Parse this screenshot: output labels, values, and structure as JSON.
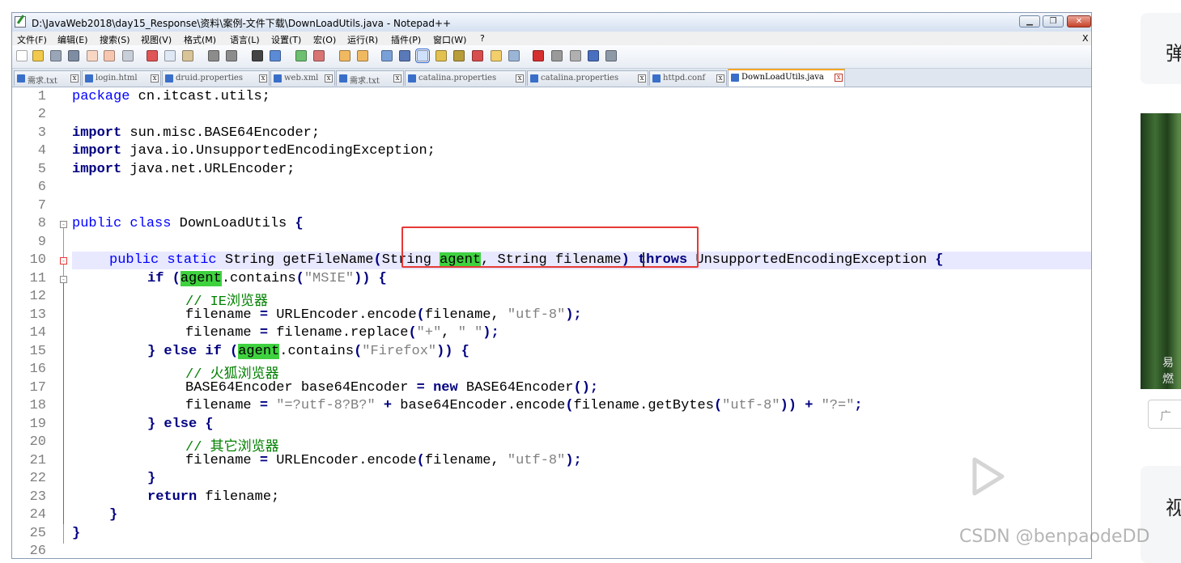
{
  "window": {
    "title": "D:\\JavaWeb2018\\day15_Response\\资料\\案例-文件下载\\DownLoadUtils.java - Notepad++",
    "minimize_glyph": "▁",
    "maximize_glyph": "❐",
    "close_glyph": "✕"
  },
  "menubar": {
    "items": [
      "文件(F)",
      "编辑(E)",
      "搜索(S)",
      "视图(V)",
      "格式(M)",
      "语言(L)",
      "设置(T)",
      "宏(O)",
      "运行(R)",
      "插件(P)",
      "窗口(W)",
      "?"
    ],
    "close_label": "X"
  },
  "tabs": [
    {
      "label": "需求.txt",
      "active": false
    },
    {
      "label": "login.html",
      "active": false
    },
    {
      "label": "druid.properties",
      "active": false
    },
    {
      "label": "web.xml",
      "active": false
    },
    {
      "label": "需求.txt",
      "active": false
    },
    {
      "label": "catalina.properties",
      "active": false
    },
    {
      "label": "catalina.properties",
      "active": false
    },
    {
      "label": "httpd.conf",
      "active": false
    },
    {
      "label": "DownLoadUtils.java",
      "active": true
    }
  ],
  "tab_close_glyph": "x",
  "editor": {
    "line_numbers": [
      "1",
      "2",
      "3",
      "4",
      "5",
      "6",
      "7",
      "8",
      "9",
      "10",
      "11",
      "12",
      "13",
      "14",
      "15",
      "16",
      "17",
      "18",
      "19",
      "20",
      "21",
      "22",
      "23",
      "24",
      "25",
      "26"
    ],
    "code": {
      "l1_kw": "package",
      "l1_rest": " cn.itcast.utils;",
      "l3_kw": "import",
      "l3_rest": " sun.misc.BASE64Encoder;",
      "l4_kw": "import",
      "l4_rest": " java.io.UnsupportedEncodingException;",
      "l5_kw": "import",
      "l5_rest": " java.net.URLEncoder;",
      "l8_kw1": "public",
      "l8_kw2": "class",
      "l8_rest": " DownLoadUtils ",
      "l8_brace": "{",
      "l10_kw1": "public",
      "l10_kw2": "static",
      "l10_a": " String getFileName",
      "l10_p1": "(",
      "l10_b": "String ",
      "l10_agent": "agent",
      "l10_c": ", String filename",
      "l10_p2": ")",
      "l10_throws": "throws",
      "l10_d": " UnsupportedEncodingException ",
      "l10_brace": "{",
      "l11_kw": "if",
      "l11_p1": " (",
      "l11_agent": "agent",
      "l11_a": ".contains",
      "l11_p2": "(",
      "l11_str": "\"MSIE\"",
      "l11_p3": ")) {",
      "l12_cm": "// IE浏览器",
      "l13_a": "filename ",
      "l13_op": "=",
      "l13_b": " URLEncoder.encode",
      "l13_p1": "(",
      "l13_c": "filename, ",
      "l13_str": "\"utf-8\"",
      "l13_p2": ");",
      "l14_a": "filename ",
      "l14_op": "=",
      "l14_b": " filename.replace",
      "l14_p1": "(",
      "l14_str1": "\"+\"",
      "l14_c": ", ",
      "l14_str2": "\" \"",
      "l14_p2": ");",
      "l15_p1": "} ",
      "l15_kw1": "else",
      "l15_kw2": "if",
      "l15_p2": " (",
      "l15_agent": "agent",
      "l15_a": ".contains",
      "l15_p3": "(",
      "l15_str": "\"Firefox\"",
      "l15_p4": ")) {",
      "l16_cm": "// 火狐浏览器",
      "l17_a": "BASE64Encoder base64Encoder ",
      "l17_op": "=",
      "l17_kw": "new",
      "l17_b": " BASE64Encoder",
      "l17_p": "();",
      "l18_a": "filename ",
      "l18_op": "=",
      "l18_str1": "\"=?utf-8?B?\"",
      "l18_op2": "+",
      "l18_b": " base64Encoder.encode",
      "l18_p1": "(",
      "l18_c": "filename.getBytes",
      "l18_p2": "(",
      "l18_str2": "\"utf-8\"",
      "l18_p3": "))",
      "l18_op3": "+",
      "l18_str3": "\"?=\"",
      "l18_p4": ";",
      "l19_p1": "} ",
      "l19_kw": "else",
      "l19_p2": " {",
      "l20_cm": "// 其它浏览器",
      "l21_a": "filename ",
      "l21_op": "=",
      "l21_b": " URLEncoder.encode",
      "l21_p1": "(",
      "l21_c": "filename, ",
      "l21_str": "\"utf-8\"",
      "l21_p2": ");",
      "l22_p": "}",
      "l23_kw": "return",
      "l23_rest": " filename;",
      "l24_p": "}",
      "l25_p": "}"
    }
  },
  "page": {
    "sidebar_char_top": "弹",
    "sidebar_image_text": "易燃",
    "sidebar_btn_text": "广",
    "sidebar_char_bottom": "视",
    "watermark": "CSDN @benpaodeDD"
  },
  "colors": {
    "keyword_blue": "#0000ff",
    "keyword_bold": "#000080",
    "string_gray": "#808080",
    "comment_green": "#008000",
    "highlight_green": "#3fd23f",
    "annotation_red": "#e53935"
  },
  "icons": {
    "toolbar": [
      "new-file-icon",
      "open-file-icon",
      "save-icon",
      "save-all-icon",
      "close-icon",
      "close-all-icon",
      "print-icon",
      "cut-icon",
      "copy-icon",
      "paste-icon",
      "undo-icon",
      "redo-icon",
      "find-icon",
      "replace-icon",
      "zoom-in-icon",
      "zoom-out-icon",
      "sync-vertical-icon",
      "sync-horizontal-icon",
      "word-wrap-icon",
      "show-all-chars-icon",
      "indent-guide-icon",
      "user-lang-icon",
      "doc-map-icon",
      "function-list-icon",
      "folder-workspace-icon",
      "monitoring-icon",
      "record-macro-icon",
      "stop-record-icon",
      "playback-icon",
      "run-macro-multiple-icon",
      "save-macro-icon"
    ]
  }
}
